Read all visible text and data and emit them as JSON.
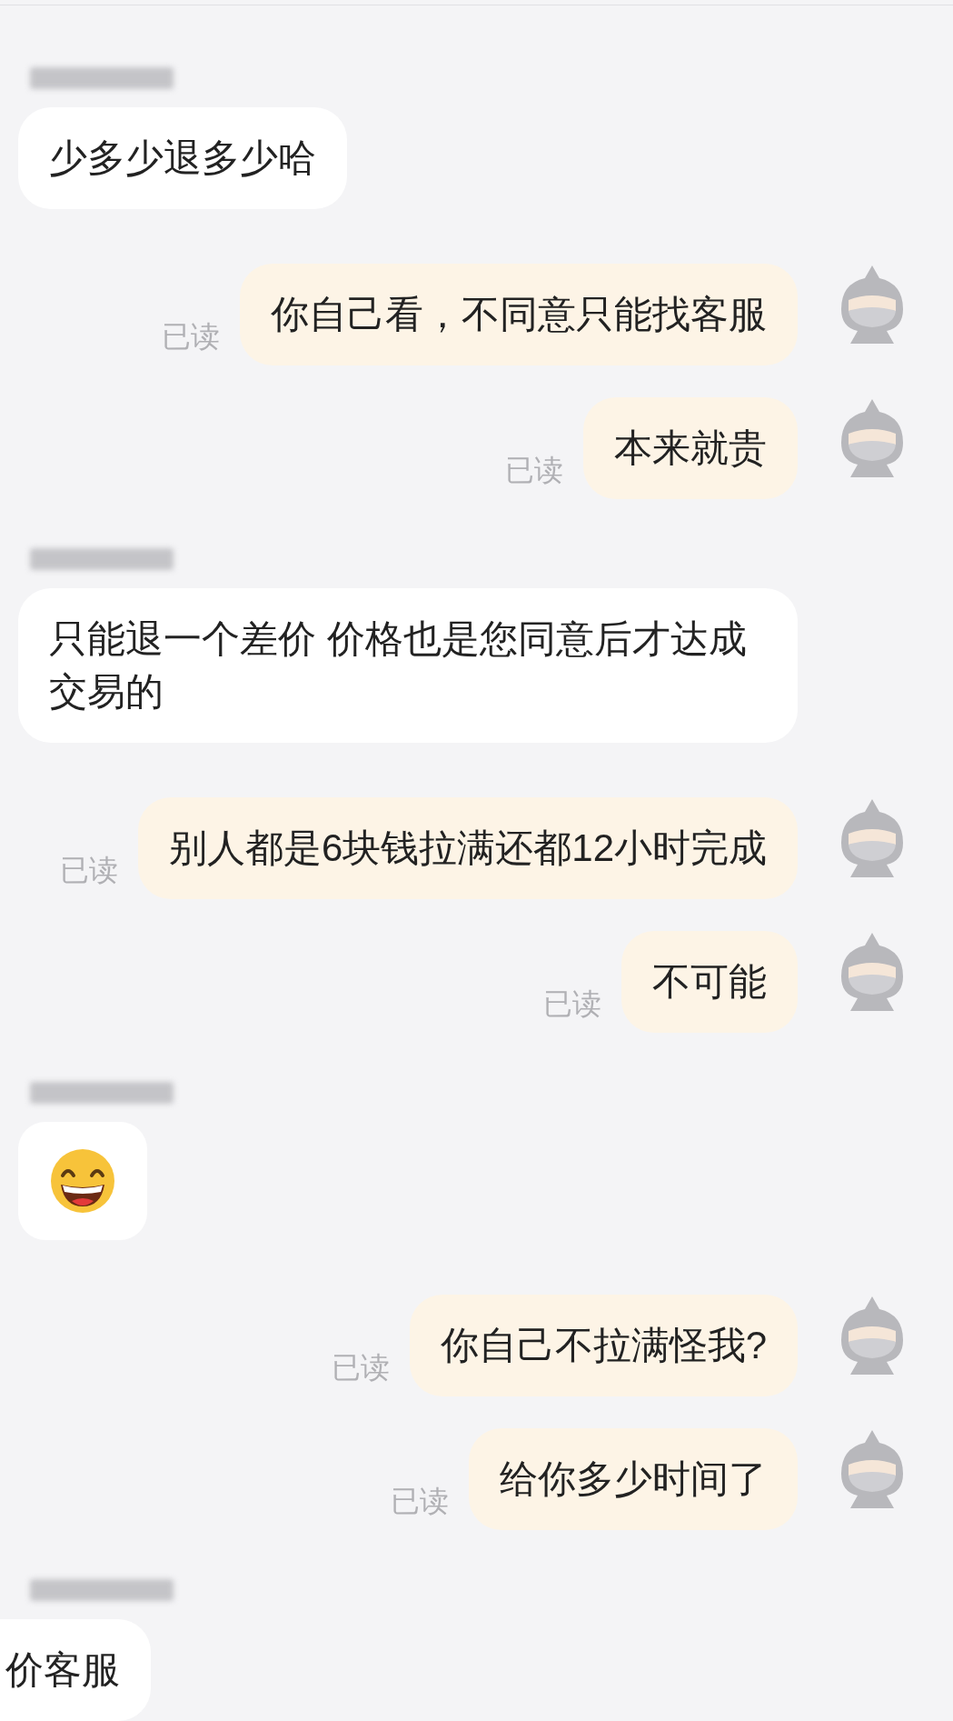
{
  "messages": [
    {
      "kind": "name"
    },
    {
      "kind": "incoming",
      "text": "少多少退多少哈"
    },
    {
      "kind": "outgoing",
      "text": "你自己看，不同意只能找客服",
      "receipt": "已读"
    },
    {
      "kind": "outgoing",
      "text": "本来就贵",
      "receipt": "已读"
    },
    {
      "kind": "name"
    },
    {
      "kind": "incoming",
      "text": "只能退一个差价 价格也是您同意后才达成交易的"
    },
    {
      "kind": "outgoing",
      "text": "别人都是6块钱拉满还都12小时完成",
      "receipt": "已读"
    },
    {
      "kind": "outgoing",
      "text": "不可能",
      "receipt": "已读"
    },
    {
      "kind": "name"
    },
    {
      "kind": "emoji"
    },
    {
      "kind": "outgoing",
      "text": "你自己不拉满怪我?",
      "receipt": "已读"
    },
    {
      "kind": "outgoing",
      "text": "给你多少时间了",
      "receipt": "已读"
    },
    {
      "kind": "name"
    },
    {
      "kind": "incoming_cut",
      "text": "价客服"
    }
  ]
}
